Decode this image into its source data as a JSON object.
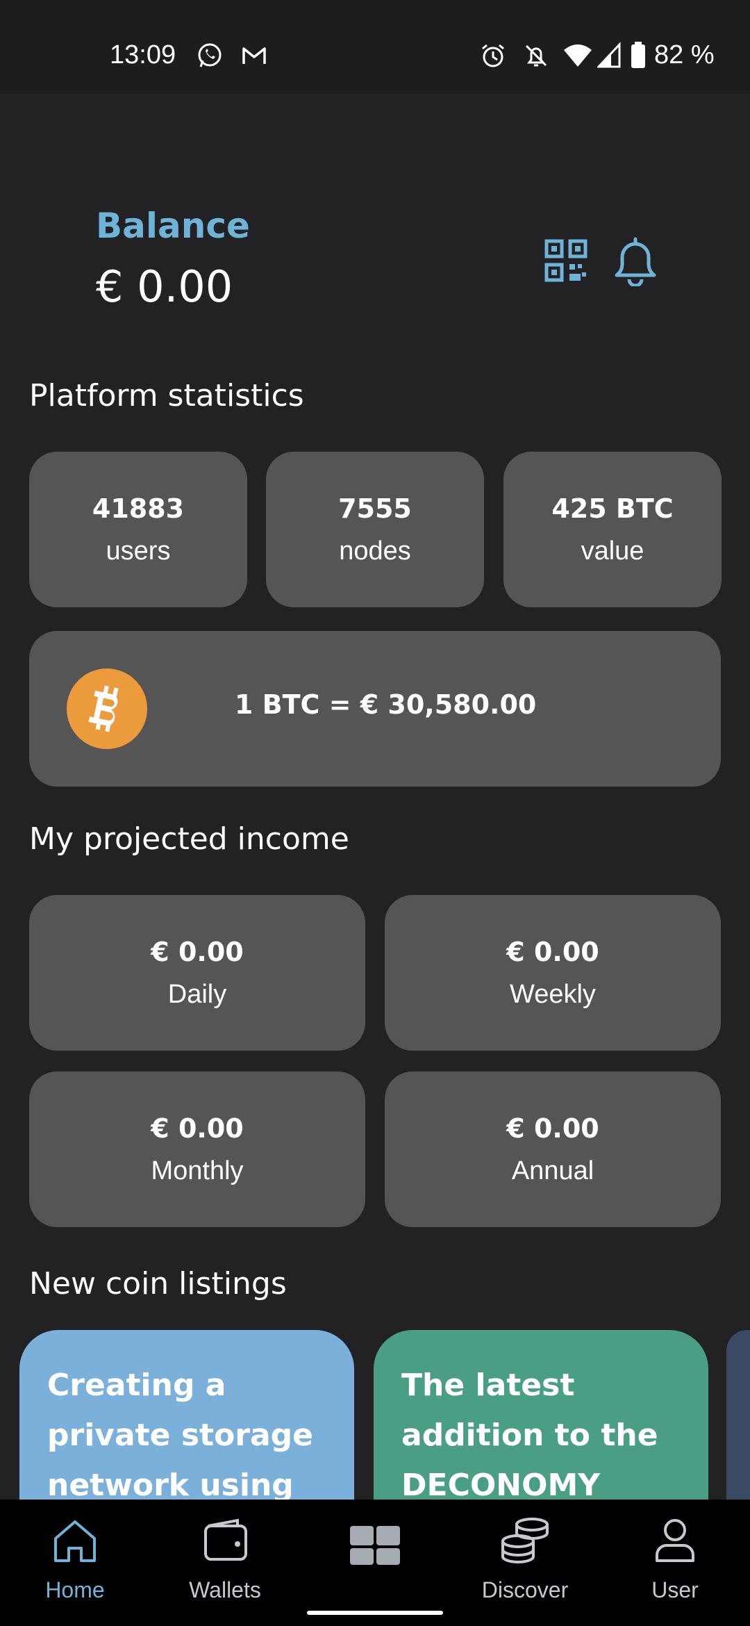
{
  "status_bar": {
    "time": "13:09",
    "battery": "82 %",
    "left_icons": [
      "whatsapp-icon",
      "gmail-icon"
    ],
    "right_icons": [
      "alarm-icon",
      "notifications-off-icon",
      "wifi-icon",
      "signal-icon",
      "battery-icon"
    ]
  },
  "header": {
    "balance_label": "Balance",
    "balance_value": "€ 0.00",
    "actions": [
      "qr-code-icon",
      "bell-icon"
    ]
  },
  "platform_statistics": {
    "title": "Platform statistics",
    "cards": [
      {
        "value": "41883",
        "label": "users"
      },
      {
        "value": "7555",
        "label": "nodes"
      },
      {
        "value": "425 BTC",
        "label": "value"
      }
    ],
    "btc_rate": "1 BTC = € 30,580.00"
  },
  "projected_income": {
    "title": "My projected income",
    "cards": [
      {
        "value": "€ 0.00",
        "label": "Daily"
      },
      {
        "value": "€ 0.00",
        "label": "Weekly"
      },
      {
        "value": "€ 0.00",
        "label": "Monthly"
      },
      {
        "value": "€ 0.00",
        "label": "Annual"
      }
    ]
  },
  "new_coin_listings": {
    "title": "New coin listings",
    "items": [
      {
        "text": "Creating a private storage network using",
        "color": "#7bb0da"
      },
      {
        "text": "The latest addition to the DECONOMY",
        "color": "#4a9e86"
      },
      {
        "text": "",
        "color": "#3a4a64"
      }
    ]
  },
  "bottom_nav": {
    "items": [
      {
        "label": "Home",
        "icon": "home-icon",
        "active": true
      },
      {
        "label": "Wallets",
        "icon": "wallet-icon",
        "active": false
      },
      {
        "label": "",
        "icon": "dashboard-grid-icon",
        "active": false
      },
      {
        "label": "Discover",
        "icon": "coins-stack-icon",
        "active": false
      },
      {
        "label": "User",
        "icon": "user-icon",
        "active": false
      }
    ]
  },
  "colors": {
    "accent": "#6fb4d8",
    "background": "#222224",
    "card": "#555556",
    "bitcoin": "#eb9a3c"
  }
}
